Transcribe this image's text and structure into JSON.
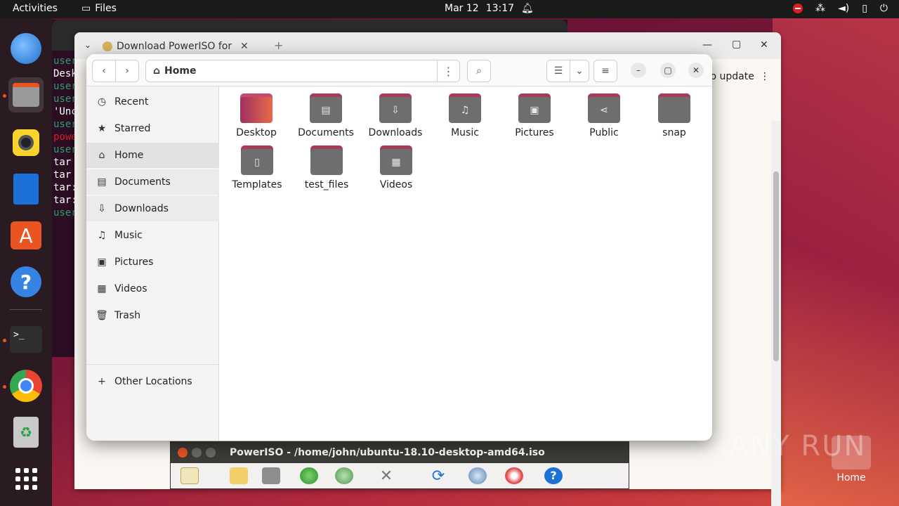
{
  "topbar": {
    "activities": "Activities",
    "app_name": "Files",
    "date": "Mar 12",
    "time": "13:17"
  },
  "terminal": {
    "lines": [
      {
        "text": "user",
        "color": "#26a269"
      },
      {
        "text": "Desk",
        "color": "#ffffff"
      },
      {
        "text": "user",
        "color": "#26a269"
      },
      {
        "text": "user",
        "color": "#26a269"
      },
      {
        "text": "'Unc",
        "color": "#ffffff"
      },
      {
        "text": "user",
        "color": "#26a269"
      },
      {
        "text": "powe",
        "color": "#e01b24"
      },
      {
        "text": "user",
        "color": "#26a269"
      },
      {
        "text": "tar ",
        "color": "#ffffff"
      },
      {
        "text": "tar ",
        "color": "#ffffff"
      },
      {
        "text": "tar:",
        "color": "#ffffff"
      },
      {
        "text": "tar:",
        "color": "#ffffff"
      },
      {
        "text": "user",
        "color": "#26a269"
      }
    ]
  },
  "browser": {
    "tab_title": "Download PowerISO for",
    "update_label": "to update"
  },
  "files": {
    "path_label": "Home",
    "sidebar": [
      {
        "label": "Recent",
        "icon": "clock-icon",
        "glyph": "◷"
      },
      {
        "label": "Starred",
        "icon": "star-icon",
        "glyph": "★"
      },
      {
        "label": "Home",
        "icon": "home-icon",
        "glyph": "⌂"
      },
      {
        "label": "Documents",
        "icon": "document-icon",
        "glyph": "▤"
      },
      {
        "label": "Downloads",
        "icon": "download-icon",
        "glyph": "⇩"
      },
      {
        "label": "Music",
        "icon": "music-icon",
        "glyph": "♫"
      },
      {
        "label": "Pictures",
        "icon": "picture-icon",
        "glyph": "▣"
      },
      {
        "label": "Videos",
        "icon": "video-icon",
        "glyph": "▦"
      },
      {
        "label": "Trash",
        "icon": "trash-icon",
        "glyph": "🗑"
      }
    ],
    "other_locations": "Other Locations",
    "folders": [
      {
        "label": "Desktop",
        "glyph": ""
      },
      {
        "label": "Documents",
        "glyph": "▤"
      },
      {
        "label": "Downloads",
        "glyph": "⇩"
      },
      {
        "label": "Music",
        "glyph": "♫"
      },
      {
        "label": "Pictures",
        "glyph": "▣"
      },
      {
        "label": "Public",
        "glyph": "⋖"
      },
      {
        "label": "snap",
        "glyph": ""
      },
      {
        "label": "Templates",
        "glyph": "▯"
      },
      {
        "label": "test_files",
        "glyph": ""
      },
      {
        "label": "Videos",
        "glyph": "▦"
      }
    ]
  },
  "poweriso": {
    "title": "PowerISO - /home/john/ubuntu-18.10-desktop-amd64.iso"
  },
  "desktop": {
    "home_label": "Home",
    "watermark": "ANY RUN"
  }
}
